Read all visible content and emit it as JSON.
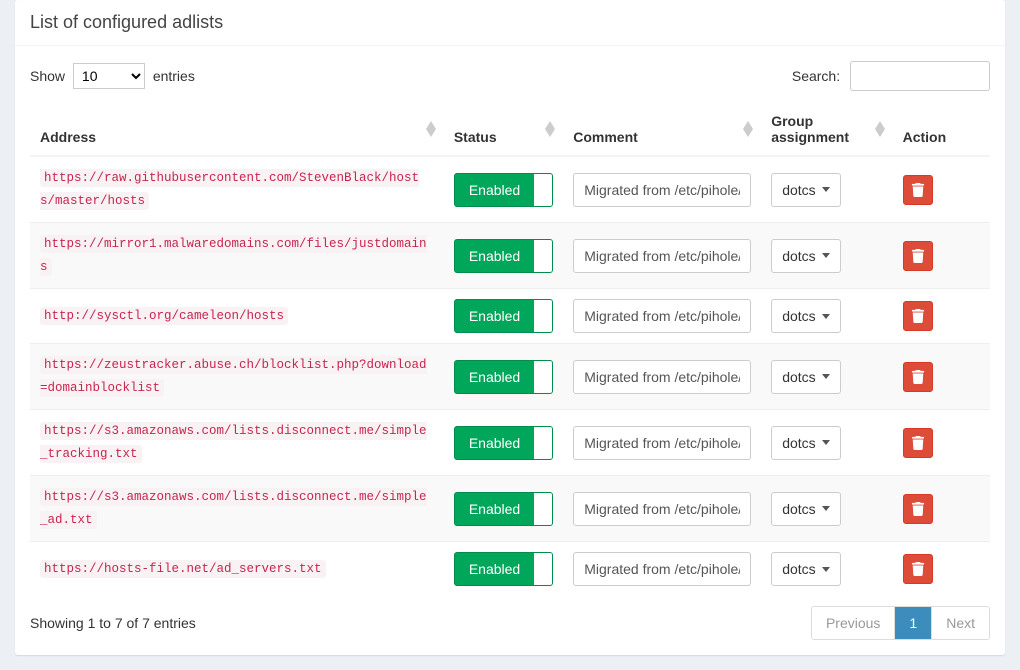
{
  "panel_title": "List of configured adlists",
  "length_menu": {
    "prefix": "Show",
    "suffix": "entries",
    "value": "10"
  },
  "search": {
    "label": "Search:",
    "value": ""
  },
  "columns": {
    "address": "Address",
    "status": "Status",
    "comment": "Comment",
    "group": "Group assignment",
    "action": "Action"
  },
  "status_label": "Enabled",
  "group_label": "dotcs",
  "rows": [
    {
      "address": "https://raw.githubusercontent.com/StevenBlack/hosts/master/hosts",
      "comment": "Migrated from /etc/pihole/"
    },
    {
      "address": "https://mirror1.malwaredomains.com/files/justdomains",
      "comment": "Migrated from /etc/pihole/"
    },
    {
      "address": "http://sysctl.org/cameleon/hosts",
      "comment": "Migrated from /etc/pihole/"
    },
    {
      "address": "https://zeustracker.abuse.ch/blocklist.php?download=domainblocklist",
      "comment": "Migrated from /etc/pihole/"
    },
    {
      "address": "https://s3.amazonaws.com/lists.disconnect.me/simple_tracking.txt",
      "comment": "Migrated from /etc/pihole/"
    },
    {
      "address": "https://s3.amazonaws.com/lists.disconnect.me/simple_ad.txt",
      "comment": "Migrated from /etc/pihole/"
    },
    {
      "address": "https://hosts-file.net/ad_servers.txt",
      "comment": "Migrated from /etc/pihole/"
    }
  ],
  "info": "Showing 1 to 7 of 7 entries",
  "pagination": {
    "previous": "Previous",
    "next": "Next",
    "current": "1"
  }
}
